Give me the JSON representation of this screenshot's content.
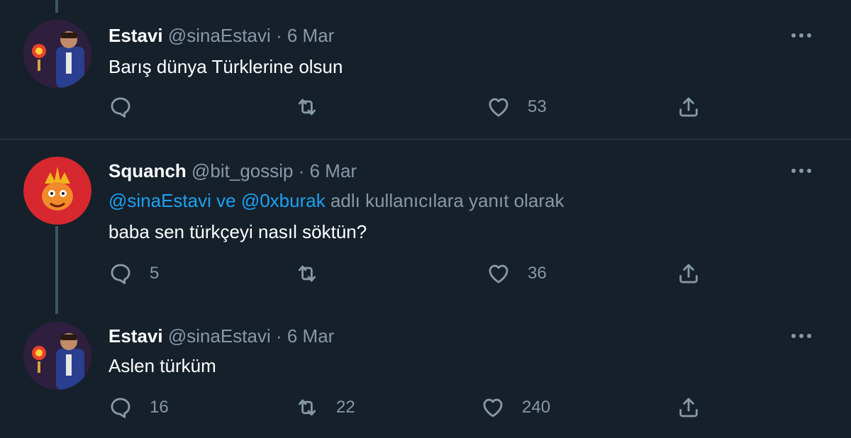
{
  "tweets": [
    {
      "name": "Estavi",
      "handle": "@sinaEstavi",
      "sep": " · ",
      "date": "6 Mar",
      "text": "Barış dünya Türklerine olsun",
      "reply_count": "",
      "retweet_count": "",
      "like_count": "53"
    },
    {
      "name": "Squanch",
      "handle": "@bit_gossip",
      "sep": " · ",
      "date": "6 Mar",
      "reply_mention_1": "@sinaEstavi",
      "reply_connector": " ve ",
      "reply_mention_2": "@0xburak",
      "reply_suffix": " adlı kullanıcılara yanıt olarak",
      "text": "baba sen türkçeyi nasıl söktün?",
      "reply_count": "5",
      "retweet_count": "",
      "like_count": "36"
    },
    {
      "name": "Estavi",
      "handle": "@sinaEstavi",
      "sep": " · ",
      "date": "6 Mar",
      "text": "Aslen türküm",
      "reply_count": "16",
      "retweet_count": "22",
      "like_count": "240"
    }
  ],
  "colors": {
    "background": "#15202b",
    "text": "#ffffff",
    "secondary": "#8899a6",
    "link": "#1da1f2",
    "divider": "#38444d",
    "thread_line": "#3d5466"
  },
  "icons": [
    "reply-icon",
    "retweet-icon",
    "like-icon",
    "share-icon",
    "more-icon"
  ]
}
